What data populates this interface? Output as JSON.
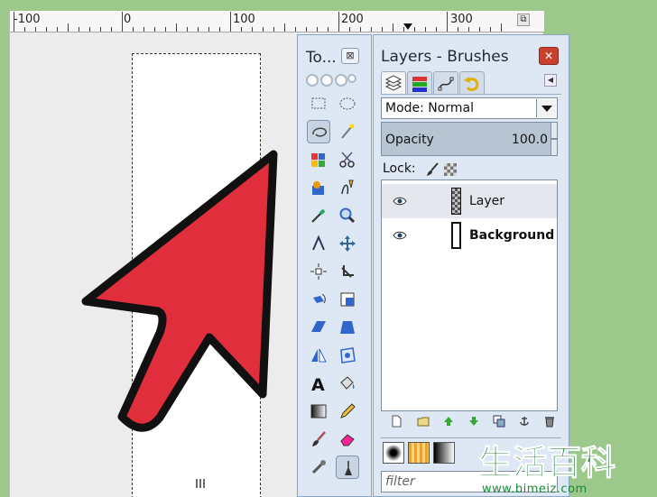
{
  "ruler": {
    "labels": [
      "-100",
      "0",
      "100",
      "200",
      "300"
    ]
  },
  "toolbox": {
    "title": "To...",
    "close_glyph": "⊠",
    "tools": [
      "rect-select-icon",
      "ellipse-select-icon",
      "free-select-icon",
      "fuzzy-select-icon",
      "color-select-icon",
      "scissors-select-icon",
      "foreground-select-icon",
      "paths-icon",
      "color-picker-icon",
      "zoom-icon",
      "measure-icon",
      "move-icon",
      "align-icon",
      "crop-icon",
      "rotate-icon",
      "scale-icon",
      "shear-icon",
      "perspective-icon",
      "flip-icon",
      "cage-transform-icon",
      "text-icon",
      "bucket-fill-icon",
      "blend-icon",
      "pencil-icon",
      "paintbrush-icon",
      "eraser-icon",
      "airbrush-icon",
      "ink-icon"
    ]
  },
  "dock": {
    "title": "Layers - Brushes",
    "close_glyph": "✕",
    "tabs": [
      "layers-tab-icon",
      "channels-tab-icon",
      "paths-tab-icon",
      "undo-history-tab-icon"
    ],
    "mode_label": "Mode: Normal",
    "opacity_label": "Opacity",
    "opacity_value": "100.0",
    "lock_label": "Lock:",
    "layers": [
      {
        "name": "Layer",
        "selected": true
      },
      {
        "name": "Background",
        "selected": false
      }
    ],
    "filter_placeholder": "filter"
  },
  "watermark": {
    "text": "生活百科",
    "url": "www.bimeiz.com"
  },
  "colors": {
    "arrow_fill": "#e02e3c",
    "arrow_outline": "#111111",
    "background": "#9cc88c",
    "dock_bg": "#dde8f4",
    "watermark_green": "#1a8a3a"
  }
}
